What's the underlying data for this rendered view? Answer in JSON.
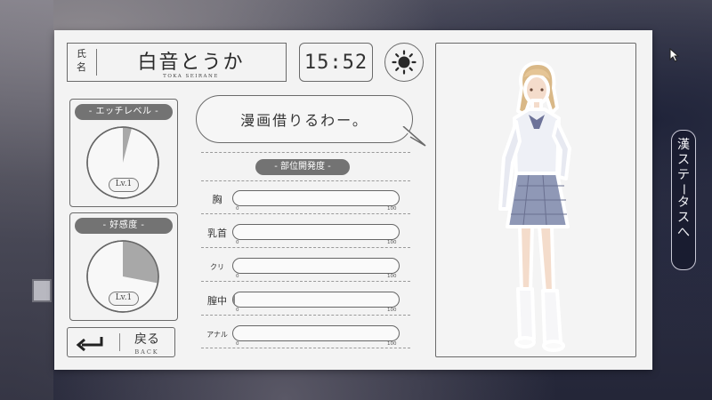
{
  "profile": {
    "name_label": "氏名",
    "name": "白音とうか",
    "romaji": "TOKA SEIRANE"
  },
  "clock": {
    "time": "15:52"
  },
  "weather": {
    "icon": "sun-icon"
  },
  "gauges": [
    {
      "label": "- エッチレベル -",
      "level": "Lv.1",
      "progress": 0.04
    },
    {
      "label": "- 好感度 -",
      "level": "Lv.1",
      "progress": 0.28
    }
  ],
  "speech": {
    "text": "漫画借りるわー。"
  },
  "body_parts": {
    "title": "- 部位開発度 -",
    "min": "0",
    "max": "100",
    "items": [
      {
        "label": "胸",
        "value": 0
      },
      {
        "label": "乳首",
        "value": 0
      },
      {
        "label": "クリ",
        "value": 0
      },
      {
        "label": "膣中",
        "value": 1
      },
      {
        "label": "アナル",
        "value": 0
      }
    ]
  },
  "back": {
    "label": "戻る",
    "sub": "BACK",
    "icon": "return-arrow-icon"
  },
  "side_tab": {
    "label": "漢ステータスへ"
  },
  "colors": {
    "panel": "#f3f3f3",
    "tag": "#737373",
    "line": "#6a6a6a",
    "gauge_fill": "#a8a8a8",
    "side_tab_bg": "#181a2e"
  }
}
